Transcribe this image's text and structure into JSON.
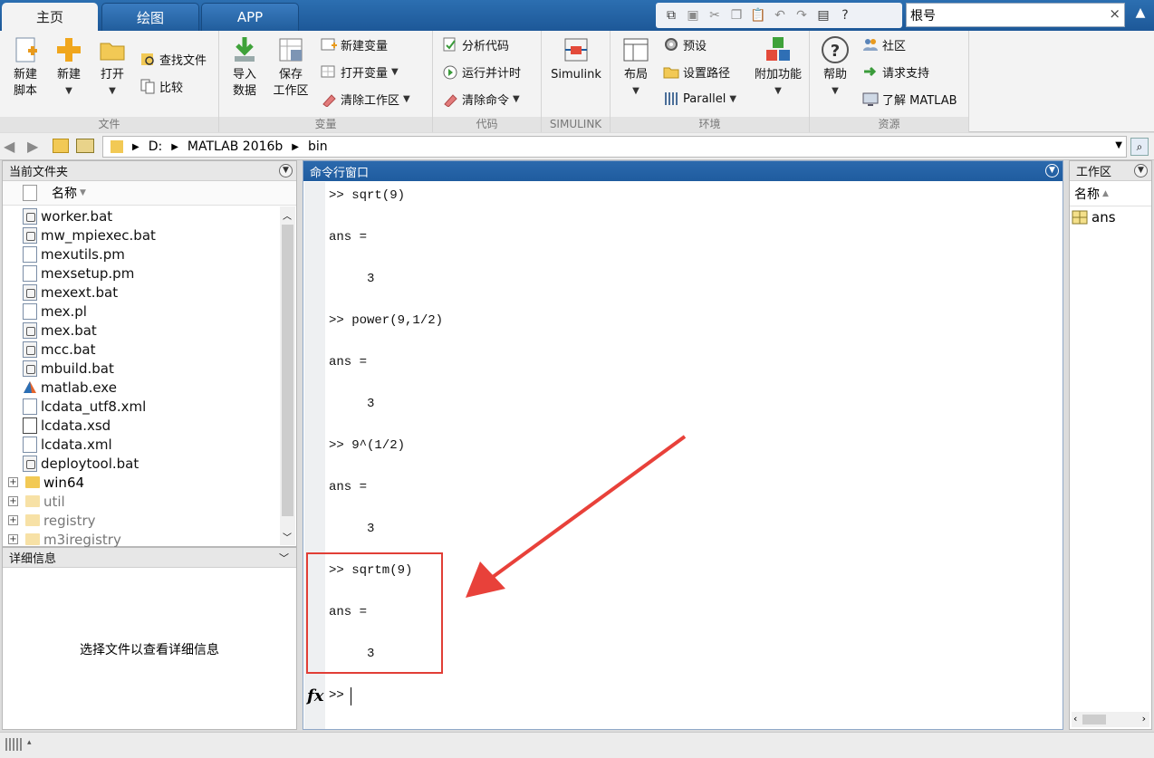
{
  "tabs": [
    {
      "label": "主页",
      "active": true
    },
    {
      "label": "绘图",
      "active": false
    },
    {
      "label": "APP",
      "active": false
    }
  ],
  "search": {
    "value": "根号",
    "clear": "×"
  },
  "ribbon": {
    "file": {
      "label": "文件",
      "new_script": [
        "新建",
        "脚本"
      ],
      "new": "新建",
      "open": "打开",
      "find_files": "查找文件",
      "compare": "比较"
    },
    "variable": {
      "label": "变量",
      "import": [
        "导入",
        "数据"
      ],
      "save_ws": [
        "保存",
        "工作区"
      ],
      "new_var": "新建变量",
      "open_var": "打开变量",
      "clear_ws": "清除工作区"
    },
    "code": {
      "label": "代码",
      "analyze": "分析代码",
      "run_time": "运行并计时",
      "clear_cmd": "清除命令"
    },
    "simulink": {
      "label": "SIMULINK",
      "button": "Simulink"
    },
    "environment": {
      "label": "环境",
      "layout": "布局",
      "preferences": "预设",
      "set_path": "设置路径",
      "parallel": "Parallel",
      "addons": "附加功能"
    },
    "resources": {
      "label": "资源",
      "help": "帮助",
      "community": "社区",
      "support": "请求支持",
      "learn": "了解 MATLAB"
    }
  },
  "address": {
    "segments": [
      "D:",
      "MATLAB 2016b",
      "bin"
    ]
  },
  "current_folder": {
    "title": "当前文件夹",
    "column": "名称",
    "files": [
      {
        "name": "worker.bat",
        "kind": "bat"
      },
      {
        "name": "mw_mpiexec.bat",
        "kind": "bat"
      },
      {
        "name": "mexutils.pm",
        "kind": "doc"
      },
      {
        "name": "mexsetup.pm",
        "kind": "doc"
      },
      {
        "name": "mexext.bat",
        "kind": "bat"
      },
      {
        "name": "mex.pl",
        "kind": "doc"
      },
      {
        "name": "mex.bat",
        "kind": "bat"
      },
      {
        "name": "mcc.bat",
        "kind": "bat"
      },
      {
        "name": "mbuild.bat",
        "kind": "bat"
      },
      {
        "name": "matlab.exe",
        "kind": "exe"
      },
      {
        "name": "lcdata_utf8.xml",
        "kind": "doc"
      },
      {
        "name": "lcdata.xsd",
        "kind": "xsd"
      },
      {
        "name": "lcdata.xml",
        "kind": "doc"
      },
      {
        "name": "deploytool.bat",
        "kind": "bat"
      }
    ],
    "folders": [
      {
        "name": "win64",
        "faded": false
      },
      {
        "name": "util",
        "faded": true
      },
      {
        "name": "registry",
        "faded": true
      },
      {
        "name": "m3iregistry",
        "faded": true
      }
    ]
  },
  "details": {
    "title": "详细信息",
    "empty_text": "选择文件以查看详细信息"
  },
  "command_window": {
    "title": "命令行窗口",
    "lines": [
      ">> sqrt(9)",
      "ans =",
      "     3",
      ">> power(9,1/2)",
      "ans =",
      "     3",
      ">> 9^(1/2)",
      "ans =",
      "     3",
      ">> sqrtm(9)",
      "ans =",
      "     3"
    ],
    "prompt": ">>",
    "fx": "fx"
  },
  "workspace": {
    "title": "工作区",
    "column": "名称",
    "variables": [
      "ans"
    ]
  },
  "colors": {
    "title_blue": "#1f5c9f",
    "highlight_red": "#e13e36",
    "arrow_red": "#e8413a"
  },
  "icons": [
    "new-script-icon",
    "new-icon",
    "open-folder-icon",
    "find-files-icon",
    "compare-icon",
    "import-data-icon",
    "save-workspace-icon",
    "new-variable-icon",
    "open-variable-icon",
    "clear-workspace-icon",
    "analyze-code-icon",
    "run-time-icon",
    "clear-commands-icon",
    "simulink-icon",
    "layout-icon",
    "preferences-icon",
    "set-path-icon",
    "parallel-icon",
    "addons-icon",
    "help-icon",
    "community-icon",
    "support-icon",
    "learn-matlab-icon"
  ]
}
